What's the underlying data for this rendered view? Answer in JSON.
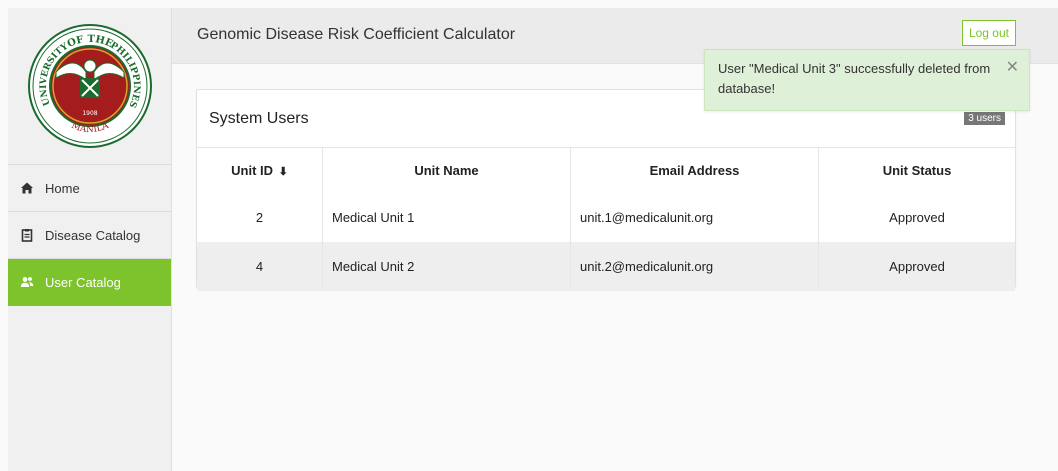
{
  "header": {
    "title": "Genomic Disease Risk Coefficient Calculator",
    "logout_label": "Log out"
  },
  "logo": {
    "top_text": "OF THE",
    "left_text": "UNIVERSITY",
    "right_text": "PHILIPPINES",
    "bottom_text": "MANILA",
    "year": "1908",
    "colors": {
      "ring": "#1a6b2e",
      "inner": "#a51c1c",
      "gold": "#d4a72c"
    }
  },
  "sidebar": {
    "items": [
      {
        "label": "Home",
        "icon": "home-icon",
        "active": false
      },
      {
        "label": "Disease Catalog",
        "icon": "clipboard-icon",
        "active": false
      },
      {
        "label": "User Catalog",
        "icon": "users-icon",
        "active": true
      }
    ]
  },
  "panel": {
    "title": "System Users",
    "badge": "3 users"
  },
  "table": {
    "headers": {
      "unit_id": "Unit ID",
      "unit_name": "Unit Name",
      "email": "Email Address",
      "status": "Unit Status"
    },
    "sort_indicator": "⬇",
    "rows": [
      {
        "unit_id": "2",
        "unit_name": "Medical Unit 1",
        "email": "unit.1@medicalunit.org",
        "status": "Approved"
      },
      {
        "unit_id": "4",
        "unit_name": "Medical Unit 2",
        "email": "unit.2@medicalunit.org",
        "status": "Approved"
      }
    ]
  },
  "toast": {
    "message": "User \"Medical Unit 3\" successfully deleted from database!",
    "close_label": "✕"
  },
  "colors": {
    "accent": "#7cc32c",
    "toast_bg": "#dff0d8",
    "badge_bg": "#777777"
  }
}
